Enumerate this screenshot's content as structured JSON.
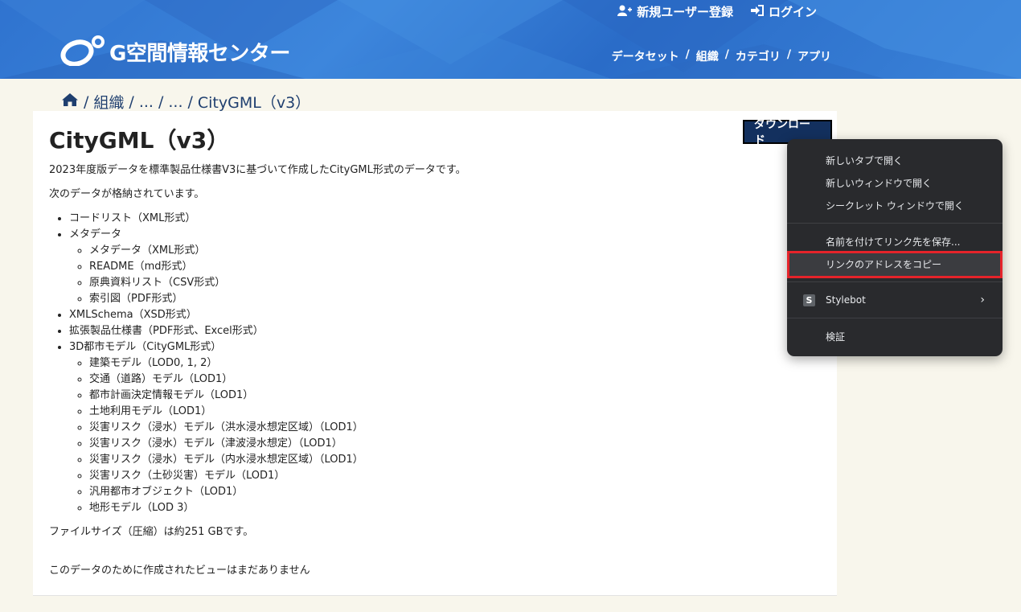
{
  "header": {
    "brand": "G空間情報センター",
    "top_links": {
      "register": "新規ユーザー登録",
      "login": "ログイン"
    },
    "nav": [
      "データセット",
      "組織",
      "カテゴリ",
      "アプリ"
    ],
    "nav_sep": "/"
  },
  "breadcrumb": {
    "items": [
      "組織",
      "...",
      "...",
      "CityGML（v3）"
    ],
    "sep": "/"
  },
  "main": {
    "title": "CityGML（v3）",
    "download_label": "ダウンロード",
    "desc": "2023年度版データを標準製品仕様書V3に基づいて作成したCityGML形式のデータです。",
    "intro": "次のデータが格納されています。",
    "list": [
      {
        "label": "コードリスト（XML形式）"
      },
      {
        "label": "メタデータ",
        "children": [
          "メタデータ（XML形式）",
          "README（md形式）",
          "原典資料リスト（CSV形式）",
          "索引図（PDF形式）"
        ]
      },
      {
        "label": "XMLSchema（XSD形式）"
      },
      {
        "label": "拡張製品仕様書（PDF形式、Excel形式）"
      },
      {
        "label": "3D都市モデル（CityGML形式）",
        "children": [
          "建築モデル（LOD0, 1, 2）",
          "交通（道路）モデル（LOD1）",
          "都市計画決定情報モデル（LOD1）",
          "土地利用モデル（LOD1）",
          "災害リスク（浸水）モデル（洪水浸水想定区域）（LOD1）",
          "災害リスク（浸水）モデル（津波浸水想定）（LOD1）",
          "災害リスク（浸水）モデル（内水浸水想定区域）（LOD1）",
          "災害リスク（土砂災害）モデル（LOD1）",
          "汎用都市オブジェクト（LOD1）",
          "地形モデル（LOD 3）"
        ]
      }
    ],
    "filesize": "ファイルサイズ（圧縮）は約251 GBです。",
    "no_views": "このデータのために作成されたビューはまだありません"
  },
  "context_menu": {
    "open_new_tab": "新しいタブで開く",
    "open_new_window": "新しいウィンドウで開く",
    "open_incognito": "シークレット ウィンドウで開く",
    "save_link_as": "名前を付けてリンク先を保存...",
    "copy_link": "リンクのアドレスをコピー",
    "stylebot": "Stylebot",
    "stylebot_icon_letter": "S",
    "inspect": "検証",
    "highlight_color": "#e5232a"
  },
  "colors": {
    "header_blue": "#2f73cf",
    "button_navy": "#13305e",
    "page_bg": "#f8f6ec",
    "menu_bg": "#292a2d"
  }
}
